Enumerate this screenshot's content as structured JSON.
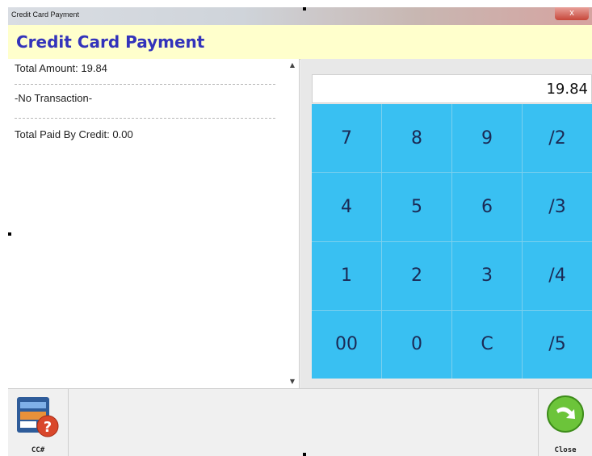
{
  "window": {
    "title": "Credit Card Payment",
    "close_glyph": "x"
  },
  "header": {
    "title": "Credit Card Payment"
  },
  "summary": {
    "total_amount": "Total Amount: 19.84",
    "transaction": "-No Transaction-",
    "total_paid": "Total Paid By Credit: 0.00"
  },
  "keypad": {
    "display_value": "19.84",
    "keys": [
      "7",
      "8",
      "9",
      "/2",
      "4",
      "5",
      "6",
      "/3",
      "1",
      "2",
      "3",
      "/4",
      "00",
      "0",
      "C",
      "/5"
    ]
  },
  "toolbar": {
    "cc_label": "CC#",
    "close_label": "Close"
  },
  "colors": {
    "header_bg": "#ffffcc",
    "header_text": "#3333bb",
    "key_bg": "#39c0f2"
  }
}
